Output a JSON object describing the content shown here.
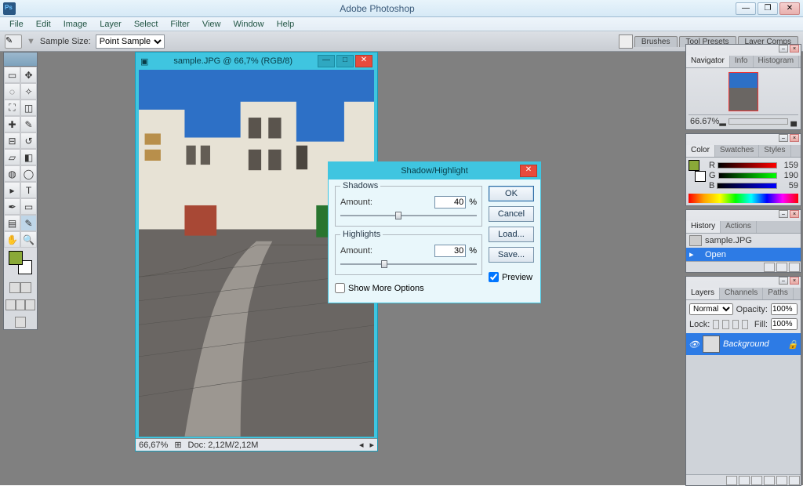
{
  "app": {
    "title": "Adobe Photoshop"
  },
  "menu": [
    "File",
    "Edit",
    "Image",
    "Layer",
    "Select",
    "Filter",
    "View",
    "Window",
    "Help"
  ],
  "options": {
    "sample_size_label": "Sample Size:",
    "sample_size_value": "Point Sample"
  },
  "tab_dock": [
    "Brushes",
    "Tool Presets",
    "Layer Comps"
  ],
  "document": {
    "title": "sample.JPG @ 66,7% (RGB/8)",
    "zoom": "66,67%",
    "docsize": "Doc: 2,12M/2,12M"
  },
  "dialog": {
    "title": "Shadow/Highlight",
    "shadows_legend": "Shadows",
    "highlights_legend": "Highlights",
    "amount_label": "Amount:",
    "percent": "%",
    "shadow_amount": "40",
    "highlight_amount": "30",
    "show_more": "Show More Options",
    "ok": "OK",
    "cancel": "Cancel",
    "load": "Load...",
    "save": "Save...",
    "preview": "Preview"
  },
  "navigator": {
    "tabs": [
      "Navigator",
      "Info",
      "Histogram"
    ],
    "zoom": "66.67%"
  },
  "color": {
    "tabs": [
      "Color",
      "Swatches",
      "Styles"
    ],
    "r": "159",
    "g": "190",
    "b": "59"
  },
  "history": {
    "tabs": [
      "History",
      "Actions"
    ],
    "doc_name": "sample.JPG",
    "step": "Open"
  },
  "layers": {
    "tabs": [
      "Layers",
      "Channels",
      "Paths"
    ],
    "blend": "Normal",
    "opacity_label": "Opacity:",
    "opacity": "100%",
    "lock_label": "Lock:",
    "fill_label": "Fill:",
    "fill": "100%",
    "bg_name": "Background"
  }
}
